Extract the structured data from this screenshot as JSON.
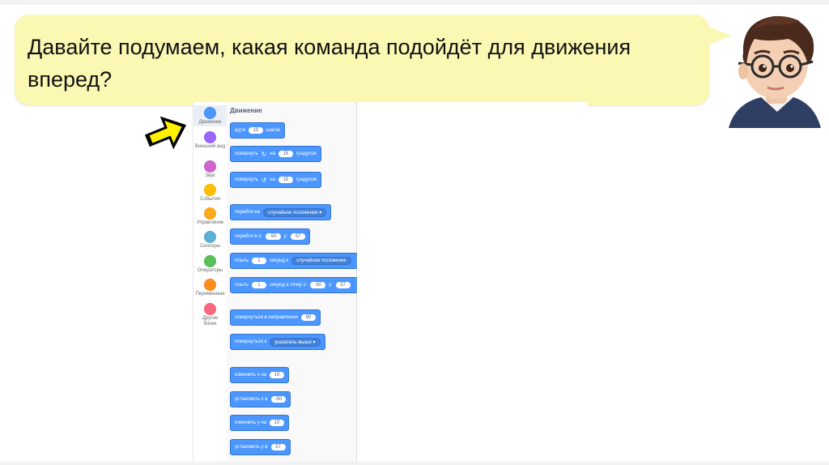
{
  "speech": {
    "text": "Давайте подумаем, какая команда подойдёт для движения вперед?"
  },
  "categories": [
    {
      "label": "Движение",
      "color": "#4c97ff"
    },
    {
      "label": "Внешний вид",
      "color": "#9966ff"
    },
    {
      "label": "Звук",
      "color": "#cf63cf"
    },
    {
      "label": "События",
      "color": "#ffbf00"
    },
    {
      "label": "Управление",
      "color": "#ffab19"
    },
    {
      "label": "Сенсоры",
      "color": "#5cb1d6"
    },
    {
      "label": "Операторы",
      "color": "#59c059"
    },
    {
      "label": "Переменные",
      "color": "#ff8c1a"
    },
    {
      "label": "Другие блоки",
      "color": "#ff6680"
    }
  ],
  "palette": {
    "title": "Движение",
    "blocks": {
      "move": {
        "pre": "идти",
        "val": "10",
        "post": "шагов"
      },
      "turn_right": {
        "pre": "повернуть",
        "icon": "↻",
        "mid": "на",
        "val": "15",
        "post": "градусов"
      },
      "turn_left": {
        "pre": "повернуть",
        "icon": "↺",
        "mid": "на",
        "val": "15",
        "post": "градусов"
      },
      "goto": {
        "pre": "перейти на",
        "drop": "случайное положение ▾"
      },
      "goto_xy": {
        "pre": "перейти в x:",
        "x": "-50",
        "mid": "y:",
        "y": "57"
      },
      "glide": {
        "pre": "плыть",
        "val": "1",
        "mid": "секунд к",
        "drop": "случайное положение"
      },
      "glide_xy": {
        "pre": "плыть",
        "val": "1",
        "mid": "секунд в точку x:",
        "x": "-50",
        "mid2": "y:",
        "y": "57"
      },
      "point_dir": {
        "pre": "повернуться в направлении",
        "val": "90"
      },
      "point_to": {
        "pre": "повернуться к",
        "drop": "указатель мыши ▾"
      },
      "change_x": {
        "pre": "изменить x на",
        "val": "10"
      },
      "set_x": {
        "pre": "установить x в",
        "val": "-50"
      },
      "change_y": {
        "pre": "изменить y на",
        "val": "10"
      },
      "set_y": {
        "pre": "установить y в",
        "val": "57"
      }
    }
  },
  "icons": {
    "pointer": "pointer-arrow-icon",
    "avatar": "teacher-avatar-icon"
  }
}
